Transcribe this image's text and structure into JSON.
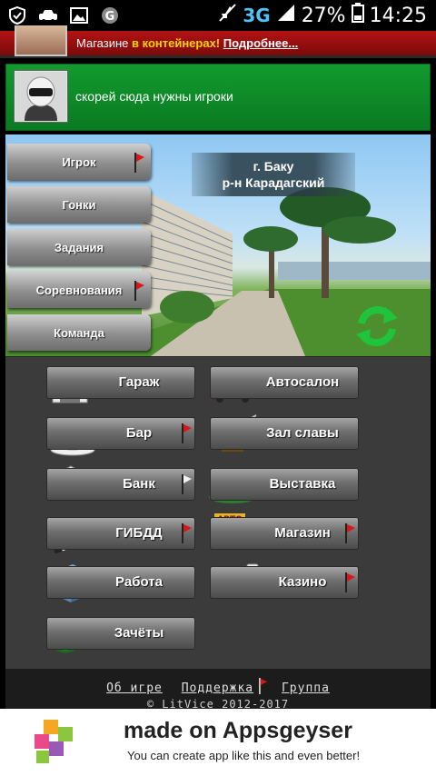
{
  "status_bar": {
    "network": "3G",
    "battery": "27%",
    "time": "14:25",
    "icons": [
      "shield-icon",
      "car-icon",
      "image-icon",
      "g-icon",
      "mute-icon",
      "signal-icon",
      "battery-icon"
    ]
  },
  "news": {
    "text": "Магазине ",
    "highlight": "в контейнерах!",
    "link": "Подробнее..."
  },
  "message": {
    "text": "скорей сюда нужны игроки"
  },
  "location": {
    "city": "г. Баку",
    "district": "р-н Карадагский"
  },
  "side_menu": [
    {
      "label": "Игрок"
    },
    {
      "label": "Гонки"
    },
    {
      "label": "Задания"
    },
    {
      "label": "Соревнования"
    },
    {
      "label": "Команда"
    }
  ],
  "menu": {
    "garage": "Гараж",
    "autosalon": "Автосалон",
    "bar": "Бар",
    "hall_of_fame": "Зал славы",
    "bank": "Банк",
    "exhibition": "Выставка",
    "gibdd": "ГИБДД",
    "shop": "Магазин",
    "work": "Работа",
    "casino": "Казино",
    "credits": "Зачёты"
  },
  "footer": {
    "about": "Об игре",
    "support": "Поддержка",
    "group": "Группа",
    "copyright": "© LitVice 2012-2017"
  },
  "ad": {
    "title": "made on Appsgeyser",
    "subtitle": "You can create app like this and even better!"
  },
  "colors": {
    "news_red": "#b31313",
    "message_green": "#129a2e",
    "flag_red": "#d81818",
    "grid_bg": "#3b3b3b"
  }
}
